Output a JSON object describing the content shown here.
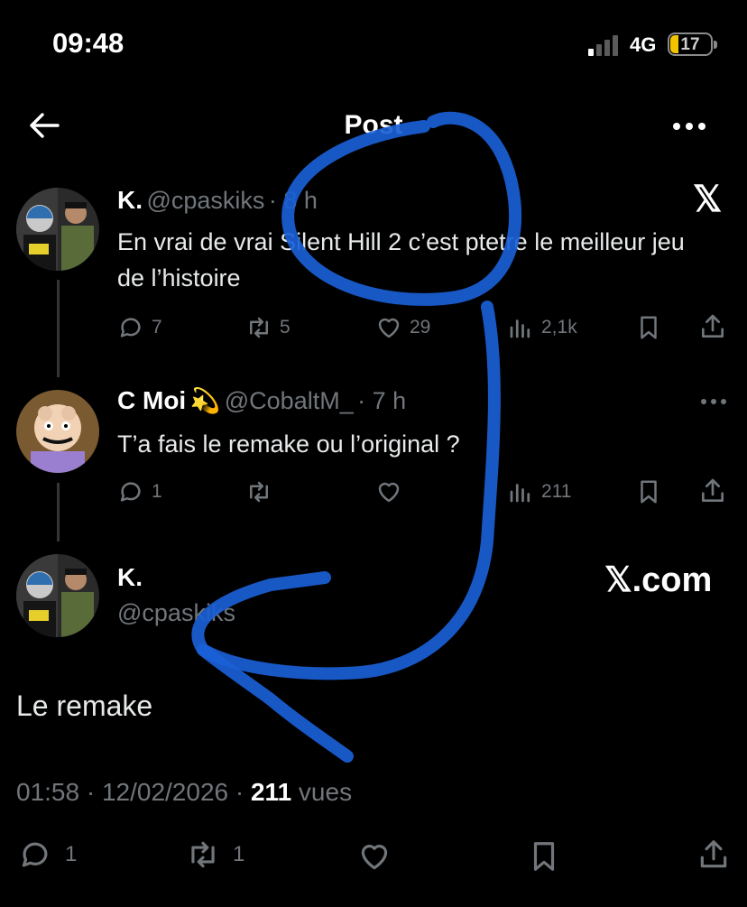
{
  "status": {
    "time": "09:48",
    "network": "4G",
    "battery": "17"
  },
  "header": {
    "title": "Post"
  },
  "tweets": [
    {
      "name": "K.",
      "handle": "@cpaskiks",
      "time": "· 8 h",
      "text": "En vrai de vrai Silent Hill 2 c’est ptetre le meilleur jeu de l’histoire",
      "replies": "7",
      "reposts": "5",
      "likes": "29",
      "views": "2,1k"
    },
    {
      "name": "C Moi",
      "emoji": "💫",
      "handle": "@CobaltM_",
      "time": "· 7 h",
      "text": "T’a fais le remake ou l’original ?",
      "replies": "1",
      "views": "211"
    }
  ],
  "main_post": {
    "name": "K.",
    "handle": "@cpaskiks",
    "text": "Le remake",
    "timestamp": "01:58 · 12/02/2026 · ",
    "views_count": "211",
    "views_label": " vues",
    "replies": "1",
    "reposts": "1"
  },
  "branding": {
    "x_logo": "𝕏",
    "x_com": "𝕏.com"
  },
  "colors": {
    "background": "#000000",
    "muted": "#71767b",
    "annotation_stroke": "#1a5fd6"
  }
}
